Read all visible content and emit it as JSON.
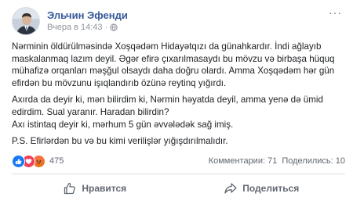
{
  "post": {
    "author": "Эльчин Эфенди",
    "timestamp": "Вчера в 14:43",
    "separator": "·",
    "audience_icon": "globe-icon",
    "menu_icon": "more-options-icon",
    "menu_glyph": "···",
    "paragraphs": [
      "Nərminin öldürülməsində Xoşqədəm Hidayətqızı da günahkardır. İndi ağlayıb maskalanmaq lazım deyil. Əgər efirə çıxarılmasaydı bu mövzu və birbaşa hüquq mühafizə orqanları məşğul olsaydı daha doğru olardı. Amma Xoşqədəm hər gün efirdən bu mövzunu işıqlandırıb özünə reytinq yığırdı.",
      "Axırda da deyir ki, mən bilirdim ki, Nərmin həyatda deyil, amma yenə də ümid edirdim. Sual yaranır. Haradan bilirdin?",
      "Axı istintaq deyir ki, mərhum 5 gün əvvələdək sağ imiş.",
      "P.S. Efirlərdən bu və bu kimi verilişlər yığışdırılmalıdır."
    ]
  },
  "stats": {
    "reactions": [
      "like",
      "love",
      "angry"
    ],
    "reaction_count": "475",
    "comments": "Комментарии: 71",
    "shares": "Поделились: 10"
  },
  "actions": {
    "like_label": "Нравится",
    "share_label": "Поделиться"
  },
  "colors": {
    "author": "#365899",
    "like": "#1877f2",
    "love": "#f33e58",
    "angry": "#e9710f",
    "muted": "#606770"
  }
}
